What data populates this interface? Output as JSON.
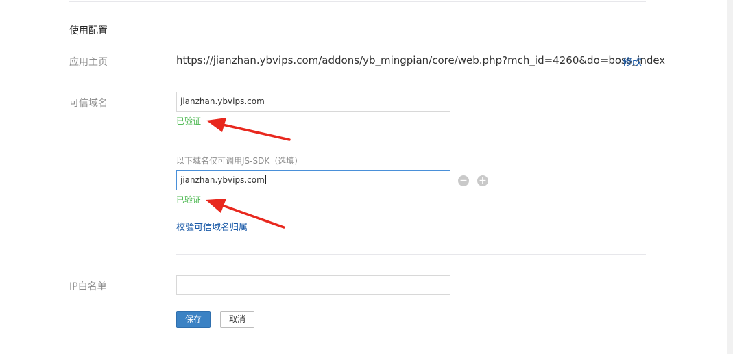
{
  "section": {
    "title": "使用配置"
  },
  "app_home": {
    "label": "应用主页",
    "url": "https://jianzhan.ybvips.com/addons/yb_mingpian/core/web.php?mch_id=4260&do=boss_index",
    "edit_label": "修改"
  },
  "trusted_domain": {
    "label": "可信域名",
    "value": "jianzhan.ybvips.com",
    "status": "已验证"
  },
  "jssdk_domain": {
    "hint": "以下域名仅可调用JS-SDK（选填）",
    "value": "jianzhan.ybvips.com",
    "status": "已验证",
    "remove_icon": "minus-circle",
    "add_icon": "plus-circle"
  },
  "verify_link": "校验可信域名归属",
  "ip_whitelist": {
    "label": "IP白名单",
    "value": ""
  },
  "actions": {
    "save_label": "保存",
    "cancel_label": "取消"
  },
  "colors": {
    "verified": "#44b549",
    "link": "#1a5aa8",
    "primary": "#3b82c4",
    "annotation_arrow": "#e8281e"
  }
}
